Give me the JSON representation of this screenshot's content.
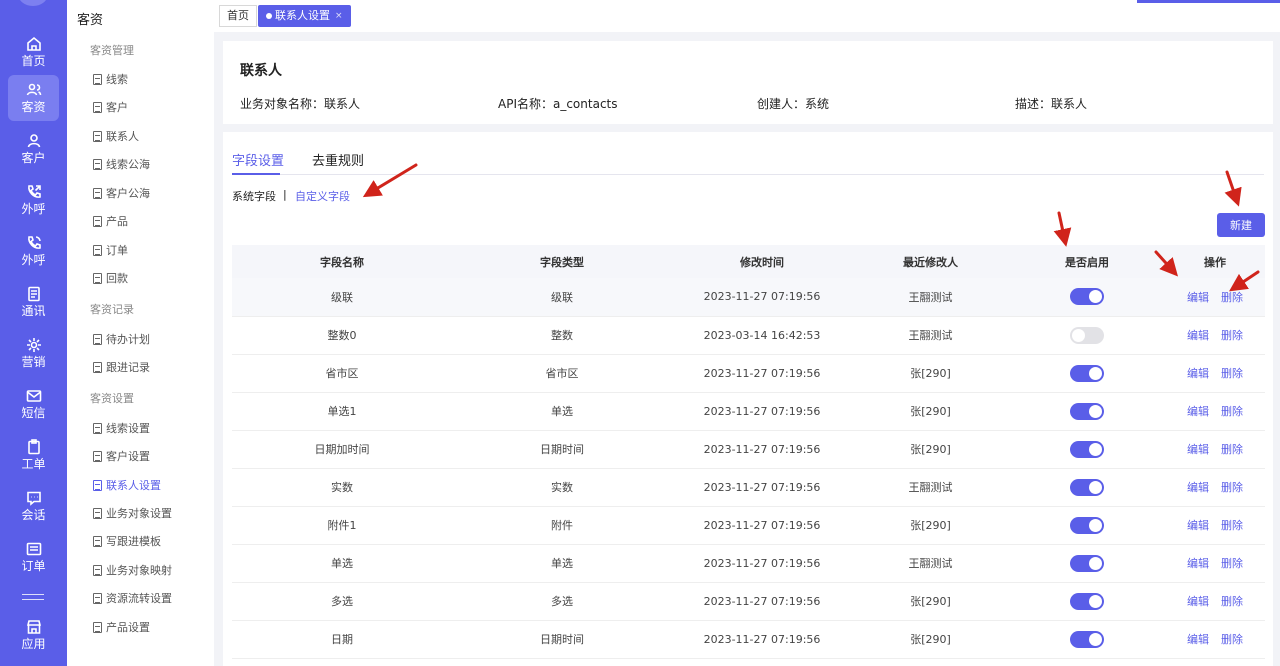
{
  "rail": {
    "items": [
      {
        "label": "首页",
        "icon": "home-icon"
      },
      {
        "label": "客资",
        "icon": "users-icon",
        "active": true
      },
      {
        "label": "客户",
        "icon": "customer-icon"
      },
      {
        "label": "外呼",
        "icon": "phone-out-icon"
      },
      {
        "label": "外呼",
        "icon": "phone-call-icon"
      },
      {
        "label": "通讯",
        "icon": "address-book-icon"
      },
      {
        "label": "营销",
        "icon": "marketing-icon"
      },
      {
        "label": "短信",
        "icon": "sms-icon"
      },
      {
        "label": "工单",
        "icon": "clipboard-icon"
      },
      {
        "label": "会话",
        "icon": "chat-icon"
      },
      {
        "label": "订单",
        "icon": "order-icon"
      },
      {
        "label": "应用",
        "icon": "app-store-icon"
      }
    ]
  },
  "subnav": {
    "title": "客资",
    "groups": [
      {
        "label": "客资管理",
        "items": [
          "线索",
          "客户",
          "联系人",
          "线索公海",
          "客户公海",
          "产品",
          "订单",
          "回款"
        ]
      },
      {
        "label": "客资记录",
        "items": [
          "待办计划",
          "跟进记录"
        ]
      },
      {
        "label": "客资设置",
        "items": [
          "线索设置",
          "客户设置",
          "联系人设置",
          "业务对象设置",
          "写跟进模板",
          "业务对象映射",
          "资源流转设置",
          "产品设置"
        ]
      }
    ],
    "active_item": "联系人设置"
  },
  "tabs": {
    "home": "首页",
    "active": "联系人设置",
    "close": "×"
  },
  "info": {
    "title": "联系人",
    "object_name": "业务对象名称：联系人",
    "api_name": "API名称：a_contacts",
    "creator": "创建人：系统",
    "description": "描述：联系人"
  },
  "main": {
    "tabs": [
      "字段设置",
      "去重规则"
    ],
    "system_fields": "系统字段",
    "separator": "|",
    "custom_fields": "自定义字段",
    "new_button": "新建",
    "columns": [
      "字段名称",
      "字段类型",
      "修改时间",
      "最近修改人",
      "是否启用",
      "操作"
    ],
    "edit_label": "编辑",
    "delete_label": "删除",
    "rows": [
      {
        "name": "级联",
        "type": "级联",
        "time": "2023-11-27 07:19:56",
        "modifier": "王翮测试",
        "enabled": true
      },
      {
        "name": "整数0",
        "type": "整数",
        "time": "2023-03-14 16:42:53",
        "modifier": "王翮测试",
        "enabled": false
      },
      {
        "name": "省市区",
        "type": "省市区",
        "time": "2023-11-27 07:19:56",
        "modifier": "张[290]",
        "enabled": true
      },
      {
        "name": "单选1",
        "type": "单选",
        "time": "2023-11-27 07:19:56",
        "modifier": "张[290]",
        "enabled": true
      },
      {
        "name": "日期加时间",
        "type": "日期时间",
        "time": "2023-11-27 07:19:56",
        "modifier": "张[290]",
        "enabled": true
      },
      {
        "name": "实数",
        "type": "实数",
        "time": "2023-11-27 07:19:56",
        "modifier": "王翮测试",
        "enabled": true
      },
      {
        "name": "附件1",
        "type": "附件",
        "time": "2023-11-27 07:19:56",
        "modifier": "张[290]",
        "enabled": true
      },
      {
        "name": "单选",
        "type": "单选",
        "time": "2023-11-27 07:19:56",
        "modifier": "王翮测试",
        "enabled": true
      },
      {
        "name": "多选",
        "type": "多选",
        "time": "2023-11-27 07:19:56",
        "modifier": "张[290]",
        "enabled": true
      },
      {
        "name": "日期",
        "type": "日期时间",
        "time": "2023-11-27 07:19:56",
        "modifier": "张[290]",
        "enabled": true
      }
    ]
  },
  "colors": {
    "accent": "#5a5ee8",
    "annotation": "#d0241b"
  }
}
